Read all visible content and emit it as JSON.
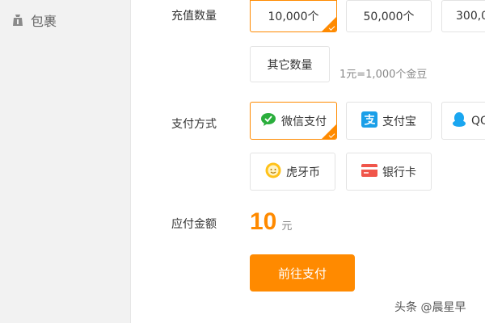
{
  "sidebar": {
    "item_label": "包裹"
  },
  "recharge": {
    "quantity_label": "充值数量",
    "options": [
      "10,000个",
      "50,000个",
      "300,0"
    ],
    "other_label": "其它数量",
    "rate_hint": "1元=1,000个金豆"
  },
  "payment": {
    "method_label": "支付方式",
    "methods": [
      "微信支付",
      "支付宝",
      "QQ",
      "虎牙币",
      "银行卡"
    ]
  },
  "total": {
    "label": "应付金额",
    "amount": "10",
    "unit": "元"
  },
  "pay_button_label": "前往支付",
  "watermark": "头条 @晨星早",
  "icons": {
    "sidebar": "package-icon",
    "wechat": "wechat-pay-icon",
    "alipay": "alipay-icon",
    "qq": "qq-icon",
    "huya": "huya-coin-icon",
    "bank": "bank-card-icon",
    "selected": "selected-check-icon"
  },
  "colors": {
    "accent": "#ff8a00",
    "sidebar_bg": "#f2f2f2",
    "wechat": "#2aae3c",
    "alipay": "#1a9fe8",
    "qq": "#1aa6f0",
    "huya": "#ffc21a",
    "bank": "#f0554a"
  }
}
